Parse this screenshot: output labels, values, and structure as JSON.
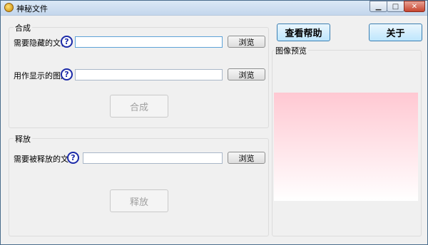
{
  "window": {
    "title": "神秘文件",
    "controls": {
      "minimize": "▁",
      "maximize": "□",
      "close": "✕"
    }
  },
  "synthesize": {
    "group_title": "合成",
    "hidden_file_label": "需要隐藏的文件",
    "hidden_file_value": "",
    "display_image_label": "用作显示的图片",
    "display_image_value": "",
    "browse_label": "浏览",
    "action_label": "合成"
  },
  "release": {
    "group_title": "释放",
    "file_label": "需要被释放的文件",
    "file_value": "",
    "browse_label": "浏览",
    "action_label": "释放"
  },
  "right": {
    "help_button": "查看帮助",
    "about_button": "关于",
    "preview_title": "图像预览"
  },
  "icons": {
    "help_glyph": "?"
  },
  "colors": {
    "preview_gradient_top": "#ffc8d2",
    "preview_gradient_bottom": "#ffffff",
    "help_icon": "#1b2aa8"
  }
}
